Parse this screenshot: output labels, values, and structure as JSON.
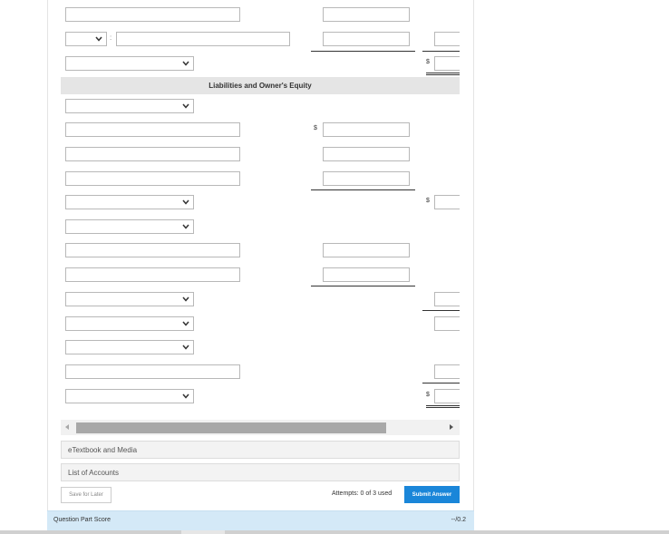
{
  "section": {
    "liabilities_header": "Liabilities and Owner's Equity"
  },
  "symbols": {
    "dollar": "$",
    "colon": ":"
  },
  "panels": {
    "etextbook": "eTextbook and Media",
    "list_of_accounts": "List of Accounts"
  },
  "actions": {
    "save_label": "Save for Later",
    "attempts_text": "Attempts: 0 of 3 used",
    "submit_label": "Submit Answer"
  },
  "score": {
    "label": "Question Part Score",
    "value": "--/0.2"
  },
  "colors": {
    "accent": "#1a86d9",
    "score_bg": "#d4e9f7",
    "header_bg": "#e5e5e5"
  }
}
